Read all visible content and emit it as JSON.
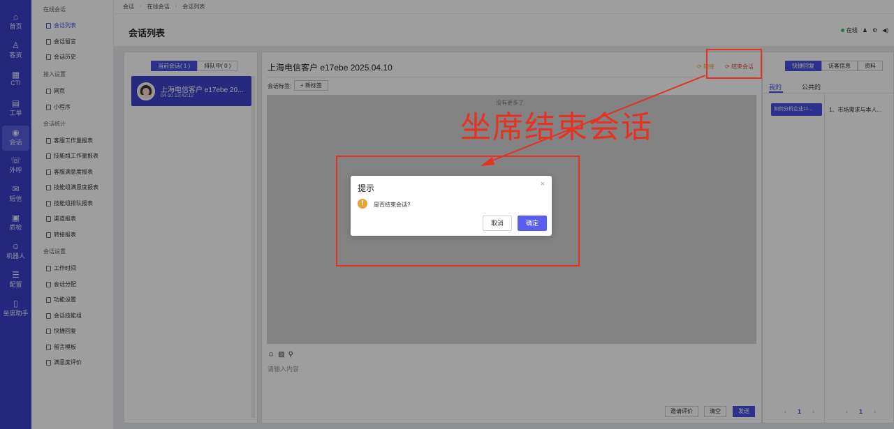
{
  "nav": [
    {
      "icon": "home-icon",
      "glyph": "⌂",
      "label": "首页"
    },
    {
      "icon": "customer-icon",
      "glyph": "♙",
      "label": "客资"
    },
    {
      "icon": "cti-icon",
      "glyph": "▦",
      "label": "CTI"
    },
    {
      "icon": "ticket-icon",
      "glyph": "▤",
      "label": "工单"
    },
    {
      "icon": "chat-icon",
      "glyph": "◉",
      "label": "会话"
    },
    {
      "icon": "phone-icon",
      "glyph": "☏",
      "label": "外呼"
    },
    {
      "icon": "sms-icon",
      "glyph": "✉",
      "label": "短信"
    },
    {
      "icon": "qc-icon",
      "glyph": "▣",
      "label": "质检"
    },
    {
      "icon": "robot-icon",
      "glyph": "☺",
      "label": "机器人"
    },
    {
      "icon": "config-icon",
      "glyph": "☰",
      "label": "配置"
    },
    {
      "icon": "assistant-icon",
      "glyph": "▯",
      "label": "坐席助手"
    }
  ],
  "menu": {
    "group1": "在线会话",
    "items1": [
      "会话列表",
      "会话留言",
      "会话历史"
    ],
    "group2": "接入设置",
    "items2": [
      "网页",
      "小程序"
    ],
    "group3": "会话统计",
    "items3": [
      "客服工作量报表",
      "技能组工作量报表",
      "客服满意度报表",
      "技能组满意度报表",
      "技能组排队报表",
      "渠道报表",
      "转接报表"
    ],
    "group4": "会话设置",
    "items4": [
      "工作时间",
      "会话分配",
      "功能设置",
      "会话技能组",
      "快捷回复",
      "留言模板",
      "满意度评价"
    ]
  },
  "breadcrumb": [
    "会话",
    "在线会话",
    "会话列表"
  ],
  "page_title": "会话列表",
  "header_status": "在线",
  "list_tabs": [
    "当前会话( 1 )",
    "排队中( 0 )"
  ],
  "session": {
    "title": "上海电信客户 e17ebe 20...",
    "time": "04-10 13:42:12"
  },
  "chat": {
    "title": "上海电信客户 e17ebe 2025.04.10",
    "transfer": "转接",
    "end": "结束会话",
    "tag_label": "会话标签:",
    "tag_btn": "+ 新标签",
    "no_more": "没有更多了",
    "input_placeholder": "请输入内容",
    "btn_invite": "邀请评价",
    "btn_clear": "清空",
    "btn_send": "发送"
  },
  "side": {
    "tabs": [
      "快捷回复",
      "访客信息",
      "资料"
    ],
    "sub_mine": "我的",
    "sub_public": "公共的",
    "qa_btn": "如何分析企业11...",
    "qa_text": "1、市场需求与本人...",
    "page": "1",
    "prev": "‹",
    "next": "›"
  },
  "dialog": {
    "title": "提示",
    "close": "×",
    "warn": "!",
    "message": "是否结束会话?",
    "cancel": "取消",
    "ok": "确定"
  },
  "annotation": "坐席结束会话",
  "colors": {
    "primary": "#4a4fe0",
    "nav": "#3b3fc8",
    "annotation_red": "#e53222",
    "warning": "#e6a23c"
  }
}
